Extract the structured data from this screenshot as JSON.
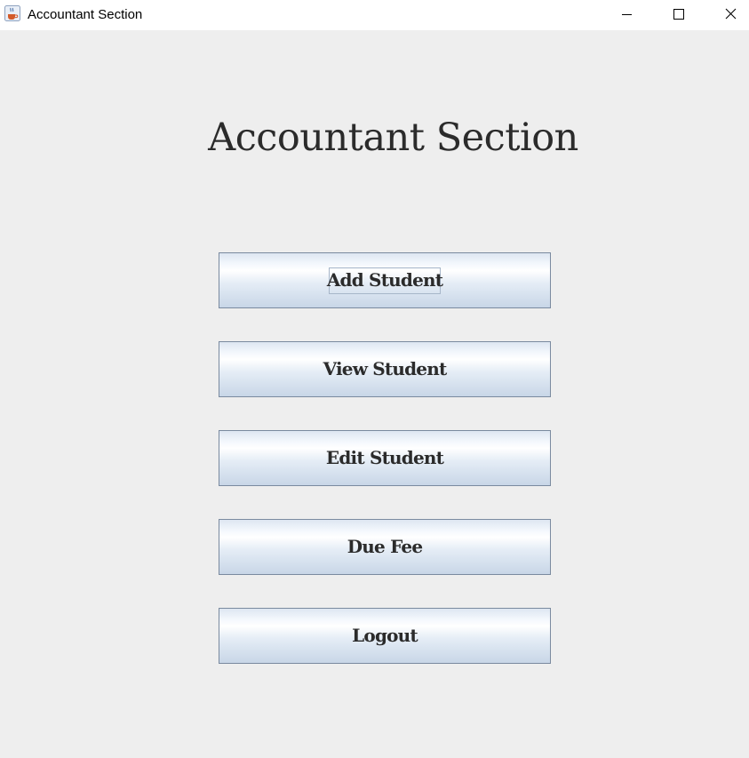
{
  "window": {
    "title": "Accountant Section",
    "icon": "java-coffee-icon",
    "controls": {
      "minimize": "minimize-icon",
      "maximize": "maximize-icon",
      "close": "close-icon"
    }
  },
  "main": {
    "heading": "Accountant Section",
    "buttons": [
      {
        "label": "Add Student",
        "focused": true
      },
      {
        "label": "View Student",
        "focused": false
      },
      {
        "label": "Edit Student",
        "focused": false
      },
      {
        "label": "Due Fee",
        "focused": false
      },
      {
        "label": "Logout",
        "focused": false
      }
    ]
  },
  "colors": {
    "background": "#eeeeee",
    "titlebar": "#ffffff",
    "text": "#2b2b2b",
    "button_border": "#7a8a9f"
  }
}
